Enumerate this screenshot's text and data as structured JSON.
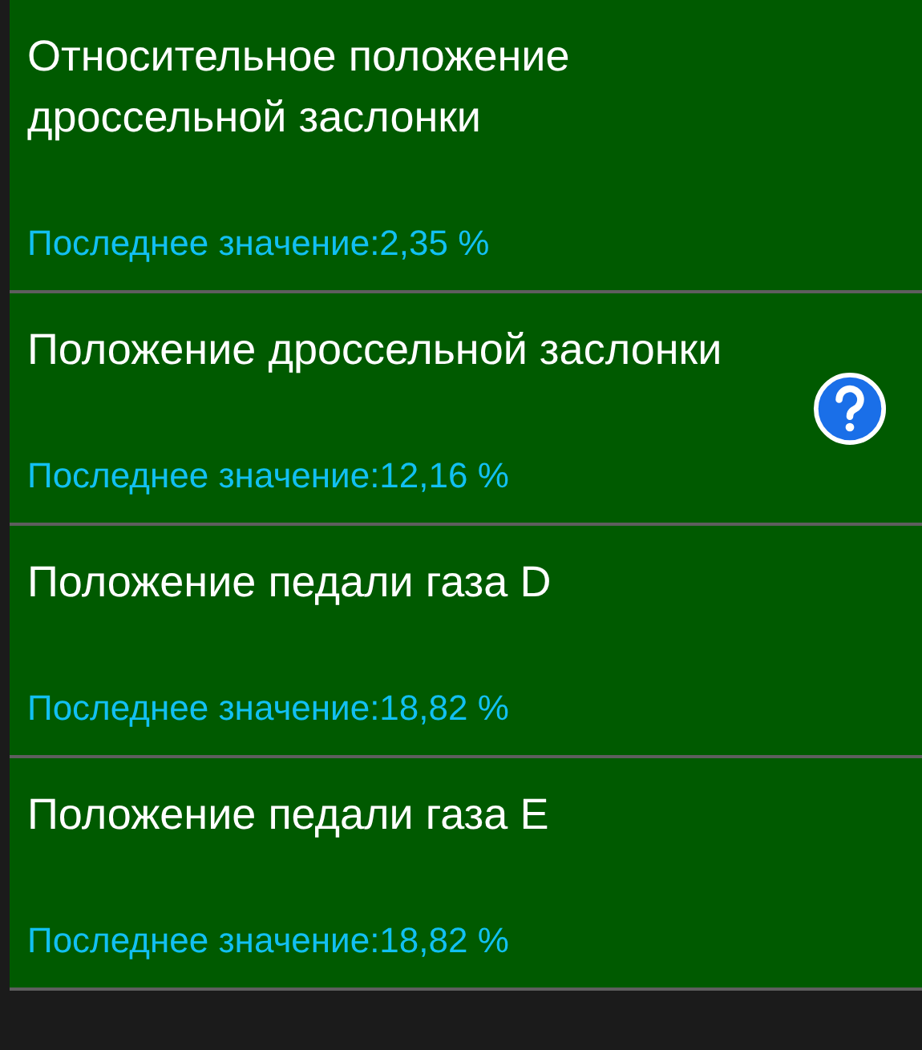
{
  "parameters": [
    {
      "name": "Относительное положение дроссельной заслонки",
      "last_value": "Последнее значение:2,35 %",
      "help": false
    },
    {
      "name": "Положение дроссельной заслонки",
      "last_value": "Последнее значение:12,16 %",
      "help": true
    },
    {
      "name": "Положение педали газа D",
      "last_value": "Последнее значение:18,82 %",
      "help": false
    },
    {
      "name": "Положение педали газа E",
      "last_value": "Последнее значение:18,82 %",
      "help": false
    }
  ]
}
